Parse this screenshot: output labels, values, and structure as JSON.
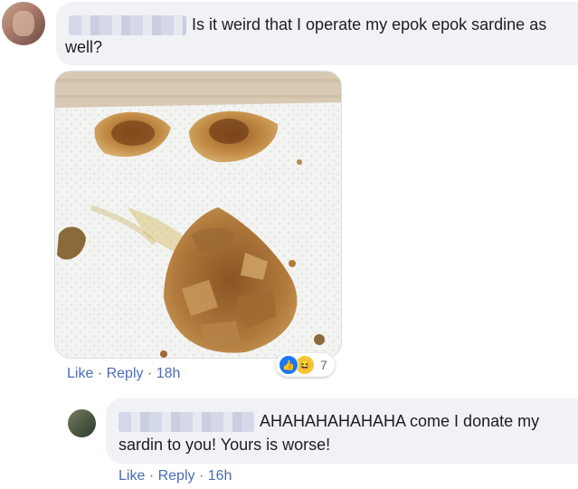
{
  "comment1": {
    "text_line1": "Is it weird that I operate my epok epok sardine as",
    "text_line2": "well?",
    "actions": {
      "like": "Like",
      "sep": "·",
      "reply": "Reply",
      "time": "18h"
    },
    "reactions": {
      "icons": [
        "like-icon",
        "haha-icon"
      ],
      "count": "7"
    }
  },
  "comment2": {
    "text_line1": "AHAHAHAHAHAHA come I donate my",
    "text_line2": "sardin to you! Yours is worse!",
    "actions": {
      "like": "Like",
      "sep": "·",
      "reply": "Reply",
      "time": "16h"
    }
  },
  "colors": {
    "bubble": "#f0f2f5",
    "link": "#4b6cb7",
    "like_blue": "#1877f2",
    "haha_yellow": "#f7c638"
  }
}
